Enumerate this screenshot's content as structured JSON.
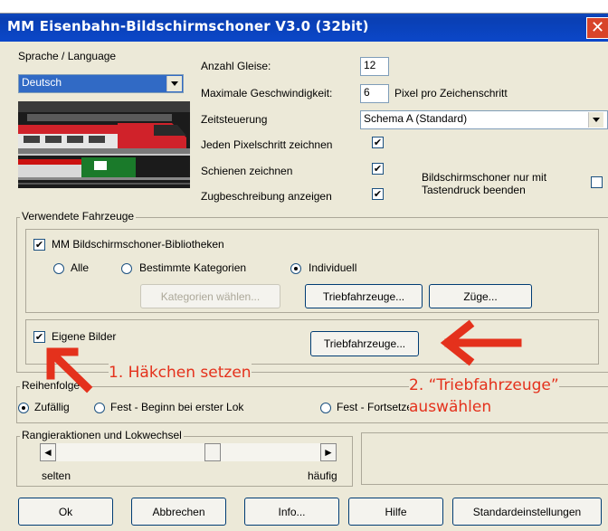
{
  "window": {
    "title": "MM Eisenbahn-Bildschirmschoner V3.0 (32bit)",
    "close_glyph": "✕"
  },
  "language": {
    "label": "Sprache / Language",
    "value": "Deutsch"
  },
  "settings": {
    "tracks_label": "Anzahl Gleise:",
    "tracks_value": "12",
    "speed_label": "Maximale Geschwindigkeit:",
    "speed_value": "6",
    "speed_unit": "Pixel pro Zeichenschritt",
    "timing_label": "Zeitsteuerung",
    "timing_value": "Schema A (Standard)",
    "draw_each_label": "Jeden Pixelschritt zeichnen",
    "draw_each_checked": "✔",
    "draw_rails_label": "Schienen zeichnen",
    "draw_rails_checked": "✔",
    "train_desc_label": "Zugbeschreibung anzeigen",
    "train_desc_checked": "✔",
    "key_end_label_1": "Bildschirmschoner nur mit",
    "key_end_label_2": "Tastendruck beenden"
  },
  "vehicles": {
    "legend": "Verwendete Fahrzeuge",
    "library_label": "MM Bildschirmschoner-Bibliotheken",
    "library_checked": "✔",
    "radio_all": "Alle",
    "radio_categories": "Bestimmte Kategorien",
    "radio_individual": "Individuell",
    "btn_categories": "Kategorien wählen...",
    "btn_locos": "Triebfahrzeuge...",
    "btn_trains": "Züge...",
    "own_images_label": "Eigene Bilder",
    "own_images_checked": "✔",
    "btn_own_locos": "Triebfahrzeuge..."
  },
  "order": {
    "legend": "Reihenfolge",
    "radio_random": "Zufällig",
    "radio_fixed_first": "Fest - Beginn bei erster Lok",
    "radio_fixed_continue": "Fest - Fortsetzen"
  },
  "shunting": {
    "legend": "Rangieraktionen und Lokwechsel",
    "min_label": "selten",
    "max_label": "häufig",
    "level": 0.6
  },
  "footer": {
    "ok": "Ok",
    "cancel": "Abbrechen",
    "info": "Info...",
    "help": "Hilfe",
    "defaults": "Standardeinstellungen"
  },
  "annotations": {
    "step1": "1. Häkchen setzen",
    "step2_line1": "2. “Triebfahrzeuge”",
    "step2_line2": "auswählen"
  },
  "colors": {
    "title_bar": "#0a3fb3",
    "annotation": "#e4311c",
    "dialog_bg": "#ece9d8"
  }
}
